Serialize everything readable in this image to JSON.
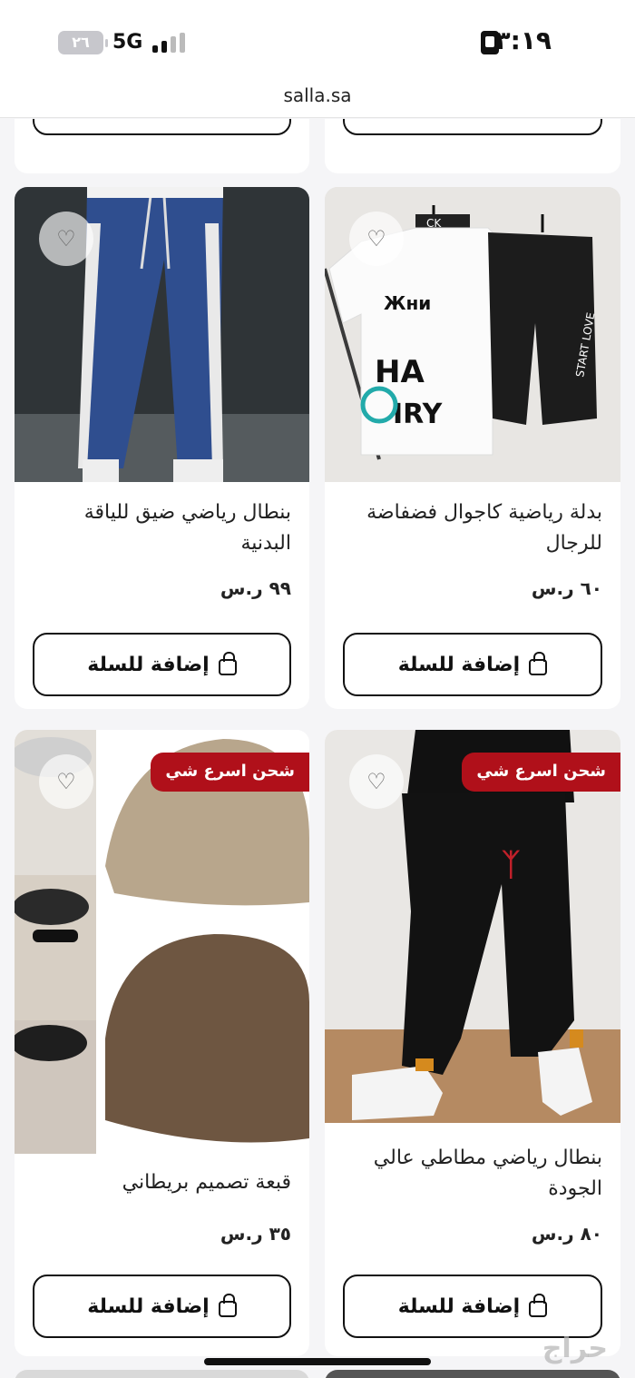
{
  "status_bar": {
    "time": "٣:١٩",
    "network": "5G",
    "battery": "٢٦"
  },
  "browser": {
    "url": "salla.sa"
  },
  "add_to_cart_label": "إضافة للسلة",
  "products": [
    {
      "name": "بدلة رياضية كاجوال فضفاضة للرجال",
      "price": "٦٠ ر.س",
      "badge": ""
    },
    {
      "name": "بنطال رياضي ضيق للياقة البدنية",
      "price": "٩٩ ر.س",
      "badge": ""
    },
    {
      "name": "بنطال رياضي مطاطي عالي الجودة",
      "price": "٨٠ ر.س",
      "badge": "شحن اسرع شي"
    },
    {
      "name": "قبعة تصميم بريطاني",
      "price": "٣٥ ر.س",
      "badge": "شحن اسرع شي"
    }
  ],
  "watermark": "حراج",
  "colors": {
    "badge": "#b0101a",
    "button_border": "#111111"
  }
}
